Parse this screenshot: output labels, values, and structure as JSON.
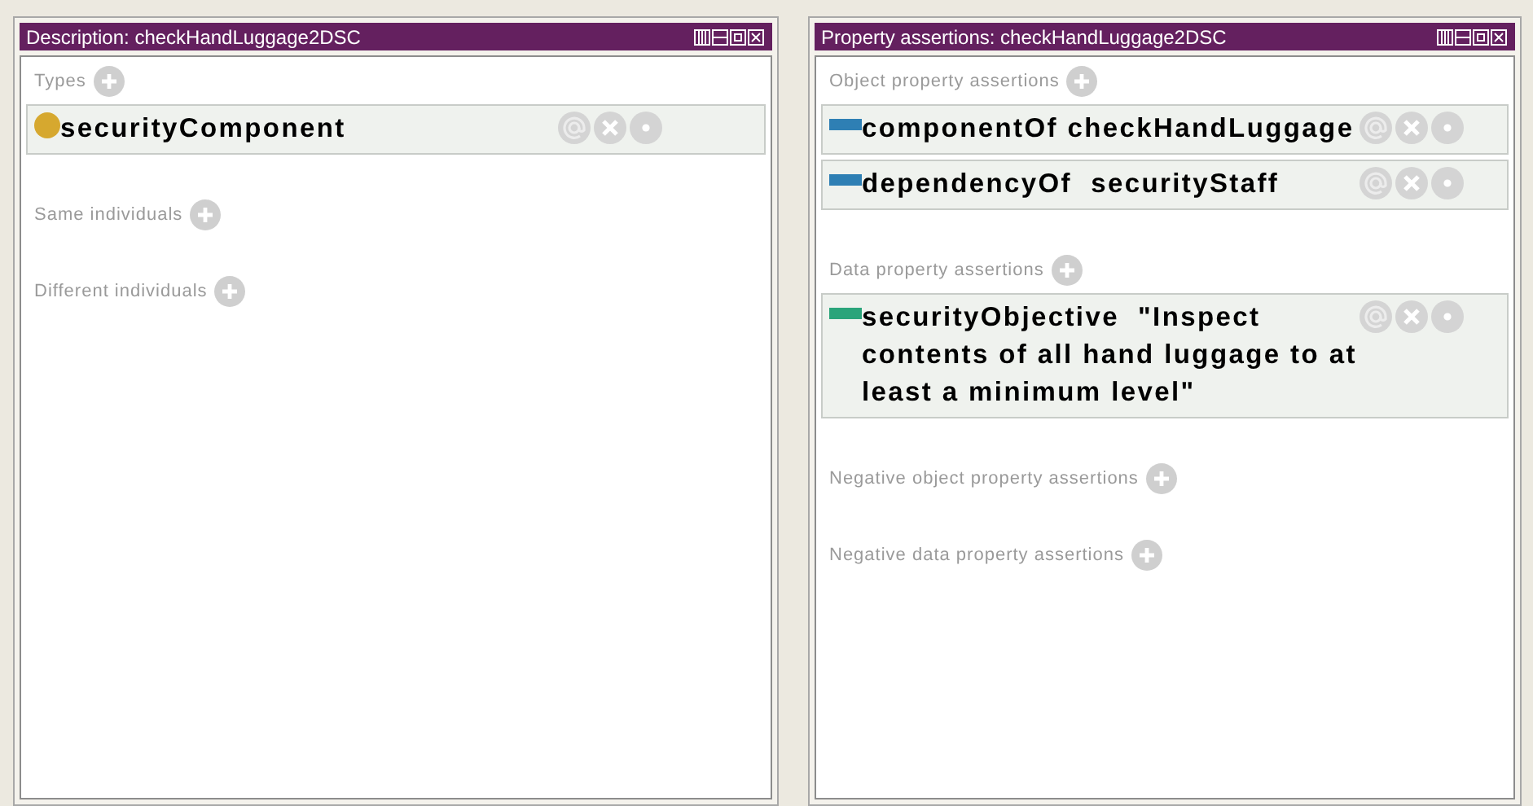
{
  "panels": [
    {
      "title": "Description: checkHandLuggage2DSC",
      "sections": [
        {
          "title": "Types",
          "items": [
            {
              "kind": "class",
              "text": "securityComponent"
            }
          ]
        },
        {
          "title": "Same individuals"
        },
        {
          "title": "Different individuals"
        }
      ]
    },
    {
      "title": "Property assertions: checkHandLuggage2DSC",
      "sections": [
        {
          "title": "Object property assertions",
          "items": [
            {
              "kind": "object",
              "text": "componentOf checkHandLuggage"
            },
            {
              "kind": "object",
              "text": "dependencyOf  securityStaff"
            }
          ]
        },
        {
          "title": "Data property assertions",
          "items": [
            {
              "kind": "data",
              "text": "securityObjective  \"Inspect contents of all hand luggage to at least a minimum level\""
            }
          ]
        },
        {
          "title": "Negative object property assertions"
        },
        {
          "title": "Negative data property assertions"
        }
      ]
    }
  ]
}
